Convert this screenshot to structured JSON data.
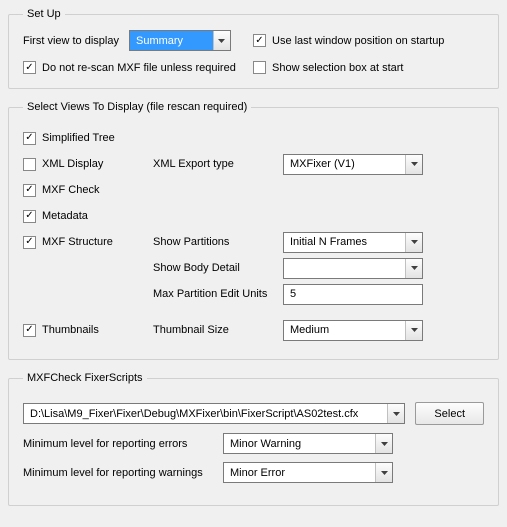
{
  "setup": {
    "legend": "Set Up",
    "first_view_label": "First view to display",
    "first_view_value": "Summary",
    "use_last_pos": {
      "label": "Use last window position on startup",
      "checked": true
    },
    "no_rescan": {
      "label": "Do not re-scan MXF file unless required",
      "checked": true
    },
    "show_sel_box": {
      "label": "Show selection box at start",
      "checked": false
    }
  },
  "views": {
    "legend": "Select Views To Display (file rescan required)",
    "simplified_tree": {
      "label": "Simplified Tree",
      "checked": true
    },
    "xml_display": {
      "label": "XML Display",
      "checked": false
    },
    "xml_export_label": "XML Export type",
    "xml_export_value": "MXFixer (V1)",
    "mxf_check": {
      "label": "MXF Check",
      "checked": true
    },
    "metadata": {
      "label": "Metadata",
      "checked": true
    },
    "mxf_structure": {
      "label": "MXF Structure",
      "checked": true
    },
    "show_partitions_label": "Show Partitions",
    "show_partitions_value": "Initial N Frames",
    "show_body_detail_label": "Show Body Detail",
    "show_body_detail_value": "",
    "max_partition_label": "Max Partition Edit Units",
    "max_partition_value": "5",
    "thumbnails": {
      "label": "Thumbnails",
      "checked": true
    },
    "thumb_size_label": "Thumbnail Size",
    "thumb_size_value": "Medium"
  },
  "fixer": {
    "legend": "MXFCheck FixerScripts",
    "path": "D:\\Lisa\\M9_Fixer\\Fixer\\Debug\\MXFixer\\bin\\FixerScript\\AS02test.cfx",
    "select_btn": "Select",
    "min_err_label": "Minimum level for reporting errors",
    "min_err_value": "Minor Warning",
    "min_warn_label": "Minimum level for reporting warnings",
    "min_warn_value": "Minor Error"
  }
}
